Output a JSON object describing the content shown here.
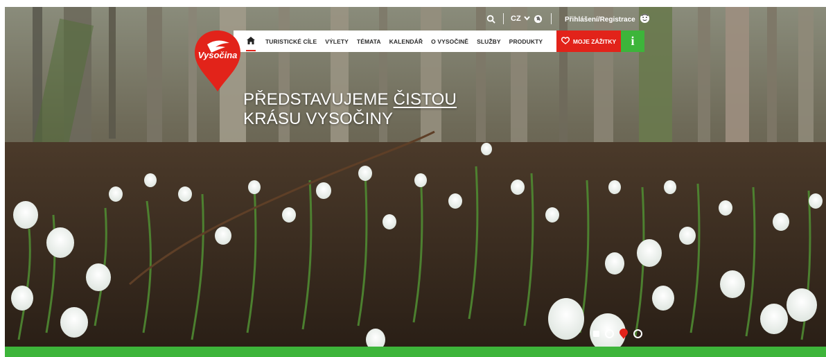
{
  "brand": {
    "name": "Vysočina",
    "red": "#e2231a",
    "green": "#3db53a"
  },
  "topbar": {
    "search_icon": "search-icon",
    "language": "CZ",
    "globe_icon": "globe-icon",
    "login_label": "Přihlášení/Registrace",
    "user_icon": "smiley-user-icon"
  },
  "nav": {
    "home_icon": "home-icon",
    "items": [
      {
        "label": "TURISTICKÉ CÍLE"
      },
      {
        "label": "VÝLETY"
      },
      {
        "label": "TÉMATA"
      },
      {
        "label": "KALENDÁŘ"
      },
      {
        "label": "O VYSOČINĚ"
      },
      {
        "label": "SLUŽBY"
      },
      {
        "label": "PRODUKTY"
      }
    ],
    "zazitky_label": "MOJE ZÁŽITKY",
    "info_label": "i"
  },
  "hero": {
    "line1_prefix": "PŘEDSTAVUJEME ",
    "line1_highlight": "ČISTOU",
    "line2": "KRÁSU VYSOČINY"
  },
  "slider": {
    "active_index": 2,
    "count": 4
  }
}
